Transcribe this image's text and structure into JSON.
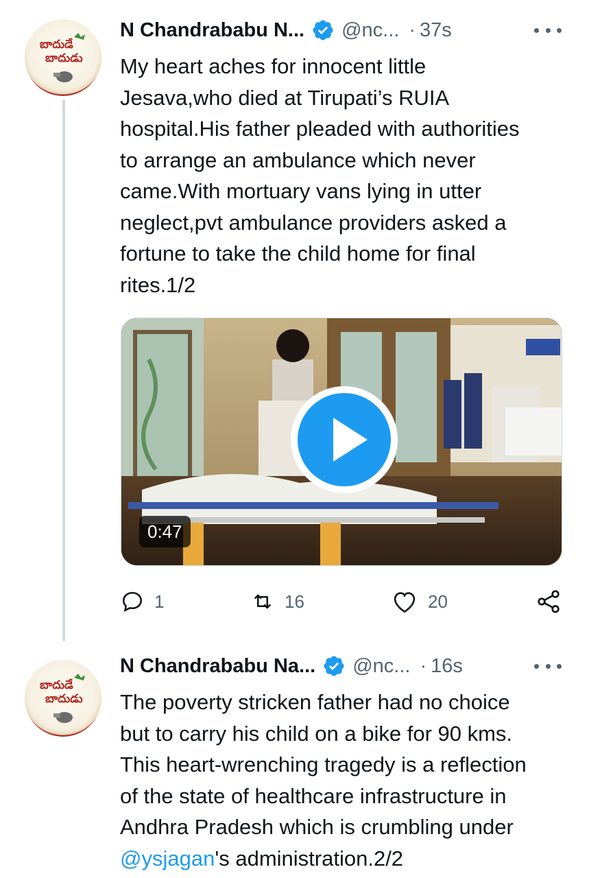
{
  "colors": {
    "accent": "#1d9bf0",
    "text_primary": "#0f1419",
    "text_secondary": "#536471",
    "thread_line": "#cfd9de"
  },
  "tweets": [
    {
      "author_name": "N Chandrababu N...",
      "handle": "@nc...",
      "separator": "·",
      "time": "37s",
      "avatar_icon": "badude-badudu-logo",
      "verified_icon": "verified-badge-icon",
      "more_icon": "more-options-icon",
      "text_lines": [
        "My heart aches for innocent little",
        "Jesava,who died at Tirupati’s RUIA",
        "hospital.His father pleaded with authorities",
        "to arrange an ambulance which never",
        "came.With mortuary vans lying in utter",
        "neglect,pvt ambulance providers asked a",
        "fortune to take the child home for final",
        "rites.1/2"
      ],
      "video": {
        "duration": "0:47",
        "play_icon": "play-icon"
      },
      "actions": {
        "reply_count": "1",
        "retweet_count": "16",
        "like_count": "20",
        "reply_icon": "reply-icon",
        "retweet_icon": "retweet-icon",
        "like_icon": "heart-icon",
        "share_icon": "share-icon"
      }
    },
    {
      "author_name": "N Chandrababu Na...",
      "handle": "@nc...",
      "separator": "·",
      "time": "16s",
      "avatar_icon": "badude-badudu-logo",
      "verified_icon": "verified-badge-icon",
      "more_icon": "more-options-icon",
      "text_lines": [
        "The poverty stricken father had no choice",
        "but to carry his child on a bike for 90 kms.",
        "This heart-wrenching tragedy is a reflection",
        "of the state of healthcare infrastructure in",
        "Andhra Pradesh which is crumbling under"
      ],
      "last_line": {
        "mention": "@ysjagan",
        "rest": "'s administration.2/2"
      }
    }
  ]
}
